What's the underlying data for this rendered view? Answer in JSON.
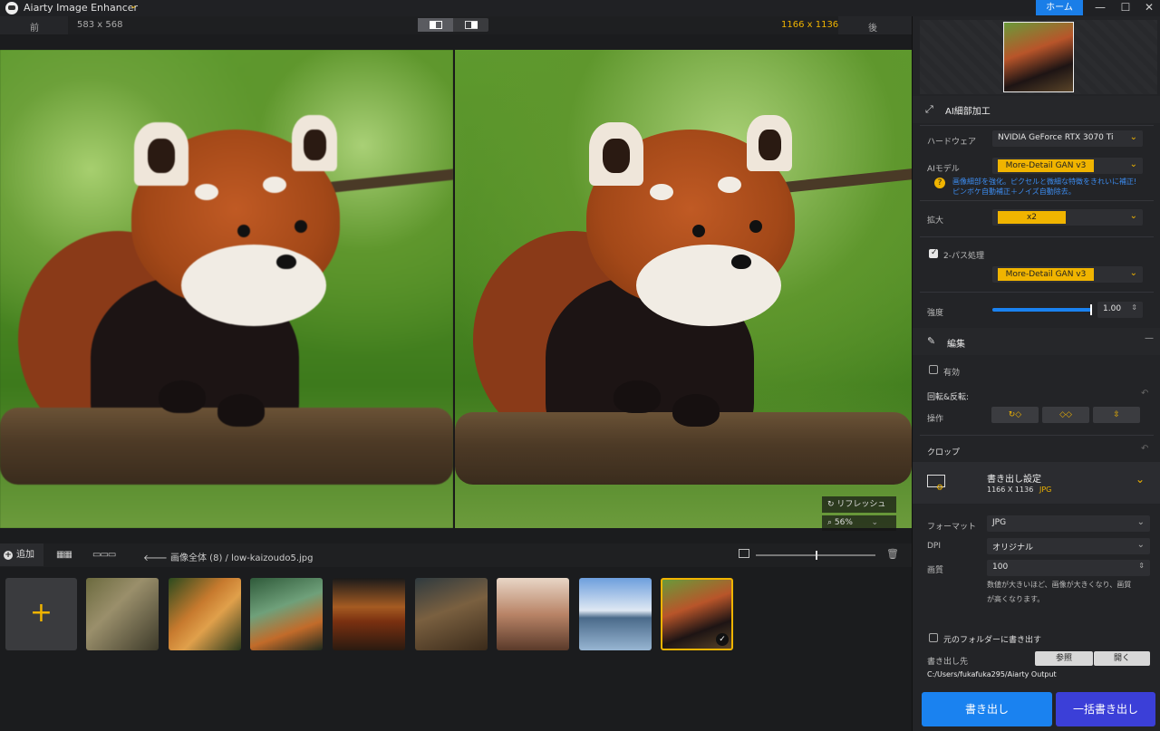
{
  "app": {
    "title": "Aiarty Image Enhancer",
    "home": "ホーム"
  },
  "toolbar": {
    "before": "前",
    "before_size": "583 x 568",
    "after_size": "1166 x 1136",
    "after": "後"
  },
  "canvas": {
    "refresh": "リフレッシュ",
    "zoom": "56%"
  },
  "bottombar": {
    "add": "追加",
    "breadcrumb_all": "画像全体 (8)",
    "breadcrumb_sep": "/",
    "filename": "low-kaizoudo5.jpg"
  },
  "thumbnails": [
    "butterfly",
    "tiger",
    "bottle-garden",
    "burger",
    "dog-steampunk",
    "portrait",
    "mount-fuji",
    "red-panda"
  ],
  "panel": {
    "ai_section": "AI細部加工",
    "hardware_label": "ハードウェア",
    "hardware_value": "NVIDIA GeForce RTX 3070 Ti",
    "model_label": "AIモデル",
    "model_value": "More-Detail GAN  v3",
    "model_help": "画像細部を強化。ピクセルと微細な特徴をきれいに補正!",
    "model_help2": "ピンボケ自動補正＋ノイズ自動除去。",
    "scale_label": "拡大",
    "scale_value": "x2",
    "twopass_label": "2-パス処理",
    "twopass_model": "More-Detail GAN  v3",
    "strength_label": "強度",
    "strength_value": "1.00",
    "strength_level": 1.0,
    "edit_section": "編集",
    "enable_label": "有効",
    "rotate_label": "回転&反転:",
    "operation_label": "操作",
    "crop_label": "クロップ",
    "export_title": "書き出し設定",
    "export_size": "1166 X 1136",
    "export_fmt": "JPG",
    "format_label": "フォーマット",
    "format_value": "JPG",
    "dpi_label": "DPI",
    "dpi_value": "オリジナル",
    "quality_label": "画質",
    "quality_value": "100",
    "quality_note": "数値が大きいほど、画像が大きくなり、画質",
    "quality_note2": "が高くなります。",
    "original_folder": "元のフォルダーに書き出す",
    "dest_label": "書き出し先",
    "browse": "参照",
    "open": "開く",
    "dest_path": "C:/Users/fukafuka295/Aiarty Output",
    "export_btn": "書き出し",
    "batch_btn": "一括書き出し"
  },
  "colors": {
    "accent": "#f0b400",
    "primary": "#1a82f0",
    "batch": "#3b3fd8"
  }
}
